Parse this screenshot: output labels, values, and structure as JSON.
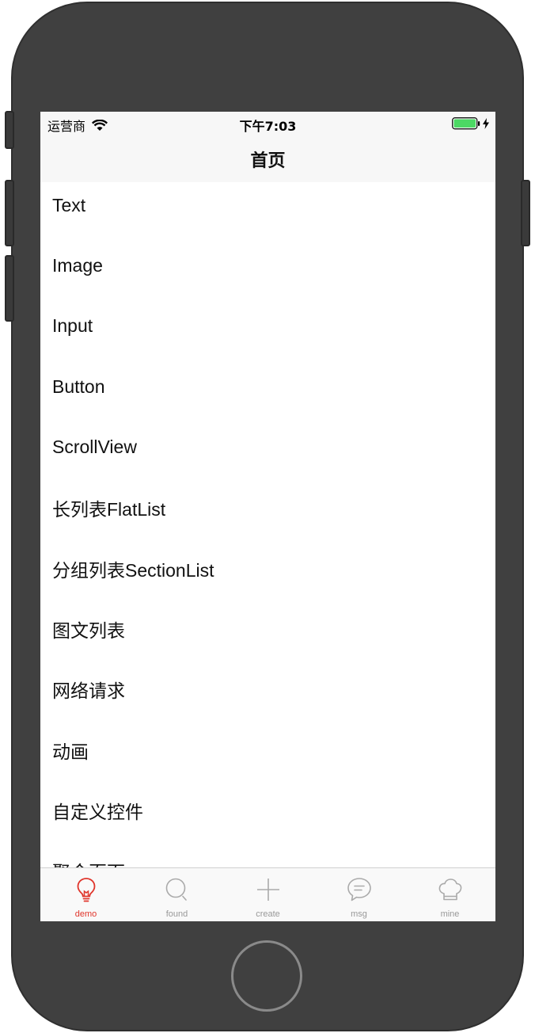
{
  "status_bar": {
    "carrier": "运营商",
    "time": "下午7:03"
  },
  "nav": {
    "title": "首页"
  },
  "list": {
    "items": [
      {
        "label": "Text"
      },
      {
        "label": "Image"
      },
      {
        "label": "Input"
      },
      {
        "label": "Button"
      },
      {
        "label": "ScrollView"
      },
      {
        "label": "长列表FlatList"
      },
      {
        "label": "分组列表SectionList"
      },
      {
        "label": "图文列表"
      },
      {
        "label": "网络请求"
      },
      {
        "label": "动画"
      },
      {
        "label": "自定义控件"
      },
      {
        "label": "聚合页面"
      }
    ]
  },
  "tabs": [
    {
      "label": "demo",
      "icon": "lightbulb-icon",
      "active": true
    },
    {
      "label": "found",
      "icon": "search-icon",
      "active": false
    },
    {
      "label": "create",
      "icon": "plus-icon",
      "active": false
    },
    {
      "label": "msg",
      "icon": "chat-bubble-icon",
      "active": false
    },
    {
      "label": "mine",
      "icon": "chef-hat-icon",
      "active": false
    }
  ],
  "colors": {
    "accent": "#e0352b",
    "inactive": "#999999",
    "battery": "#4cd964",
    "device_body": "#404040"
  }
}
